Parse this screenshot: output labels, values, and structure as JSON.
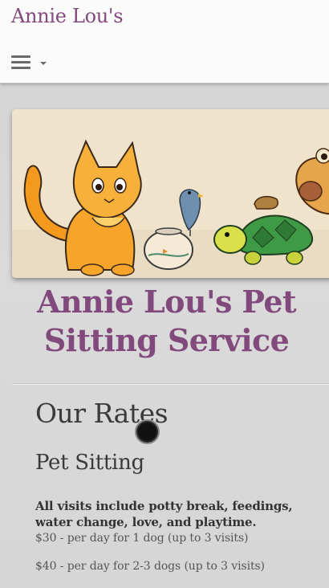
{
  "header": {
    "site_title": "Annie Lou's",
    "menu_icon": "hamburger-icon",
    "menu_caret": "caret-down-icon",
    "title_color": "#824a7c"
  },
  "hero": {
    "image_description_icon": "pet-illustration-image"
  },
  "main": {
    "page_title": "Annie Lou's Pet Sitting Service",
    "rates_heading": "Our Rates",
    "section_heading": "Pet Sitting",
    "visits_note": "All visits include potty break, feedings, water change, love, and playtime.",
    "prices": [
      "$30 - per day for 1 dog (up to 3 visits)",
      "$40 - per day for 2-3 dogs (up to 3 visits)"
    ]
  }
}
